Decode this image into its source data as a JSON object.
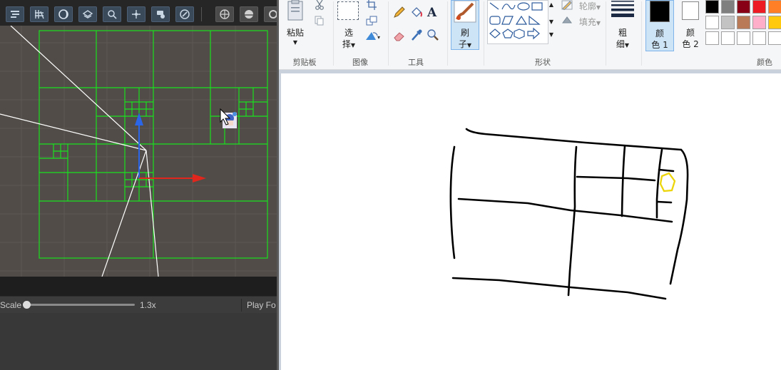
{
  "editor": {
    "scale_label": "Scale",
    "scale_value": "1.3x",
    "play_label": "Play Fo",
    "toolbar_icons": [
      "transform-icon",
      "grid-icon",
      "moon-icon",
      "layers-icon",
      "search-icon",
      "move-icon",
      "camera-icon",
      "compass-icon",
      "globe-icon",
      "sphere-icon",
      "settings-icon"
    ]
  },
  "paint": {
    "clipboard": {
      "paste_label": "粘贴",
      "group": "剪贴板"
    },
    "image": {
      "select_line1": "选",
      "select_line2": "择",
      "group": "图像"
    },
    "tools": {
      "group": "工具"
    },
    "brush": {
      "line1": "刷",
      "line2": "子"
    },
    "shapes": {
      "outline_label": "轮廓",
      "fill_label": "填充",
      "group": "形状"
    },
    "size": {
      "line1": "粗",
      "line2": "细"
    },
    "color1": {
      "line1": "颜",
      "line2": "色 1"
    },
    "color2": {
      "line1": "颜",
      "line2": "色 2"
    },
    "colors_group": "颜色",
    "palette_row1": [
      "#000000",
      "#7f7f7f",
      "#880015",
      "#ed1c24",
      "#ff7f27"
    ],
    "palette_row2": [
      "#ffffff",
      "#c3c3c3",
      "#b97a57",
      "#ffaec9",
      "#ffc90e"
    ],
    "palette_row3": [
      "#ffffff",
      "#ffffff",
      "#ffffff",
      "#ffffff",
      "#ffffff"
    ],
    "color1_value": "#000000",
    "color2_value": "#ffffff"
  }
}
